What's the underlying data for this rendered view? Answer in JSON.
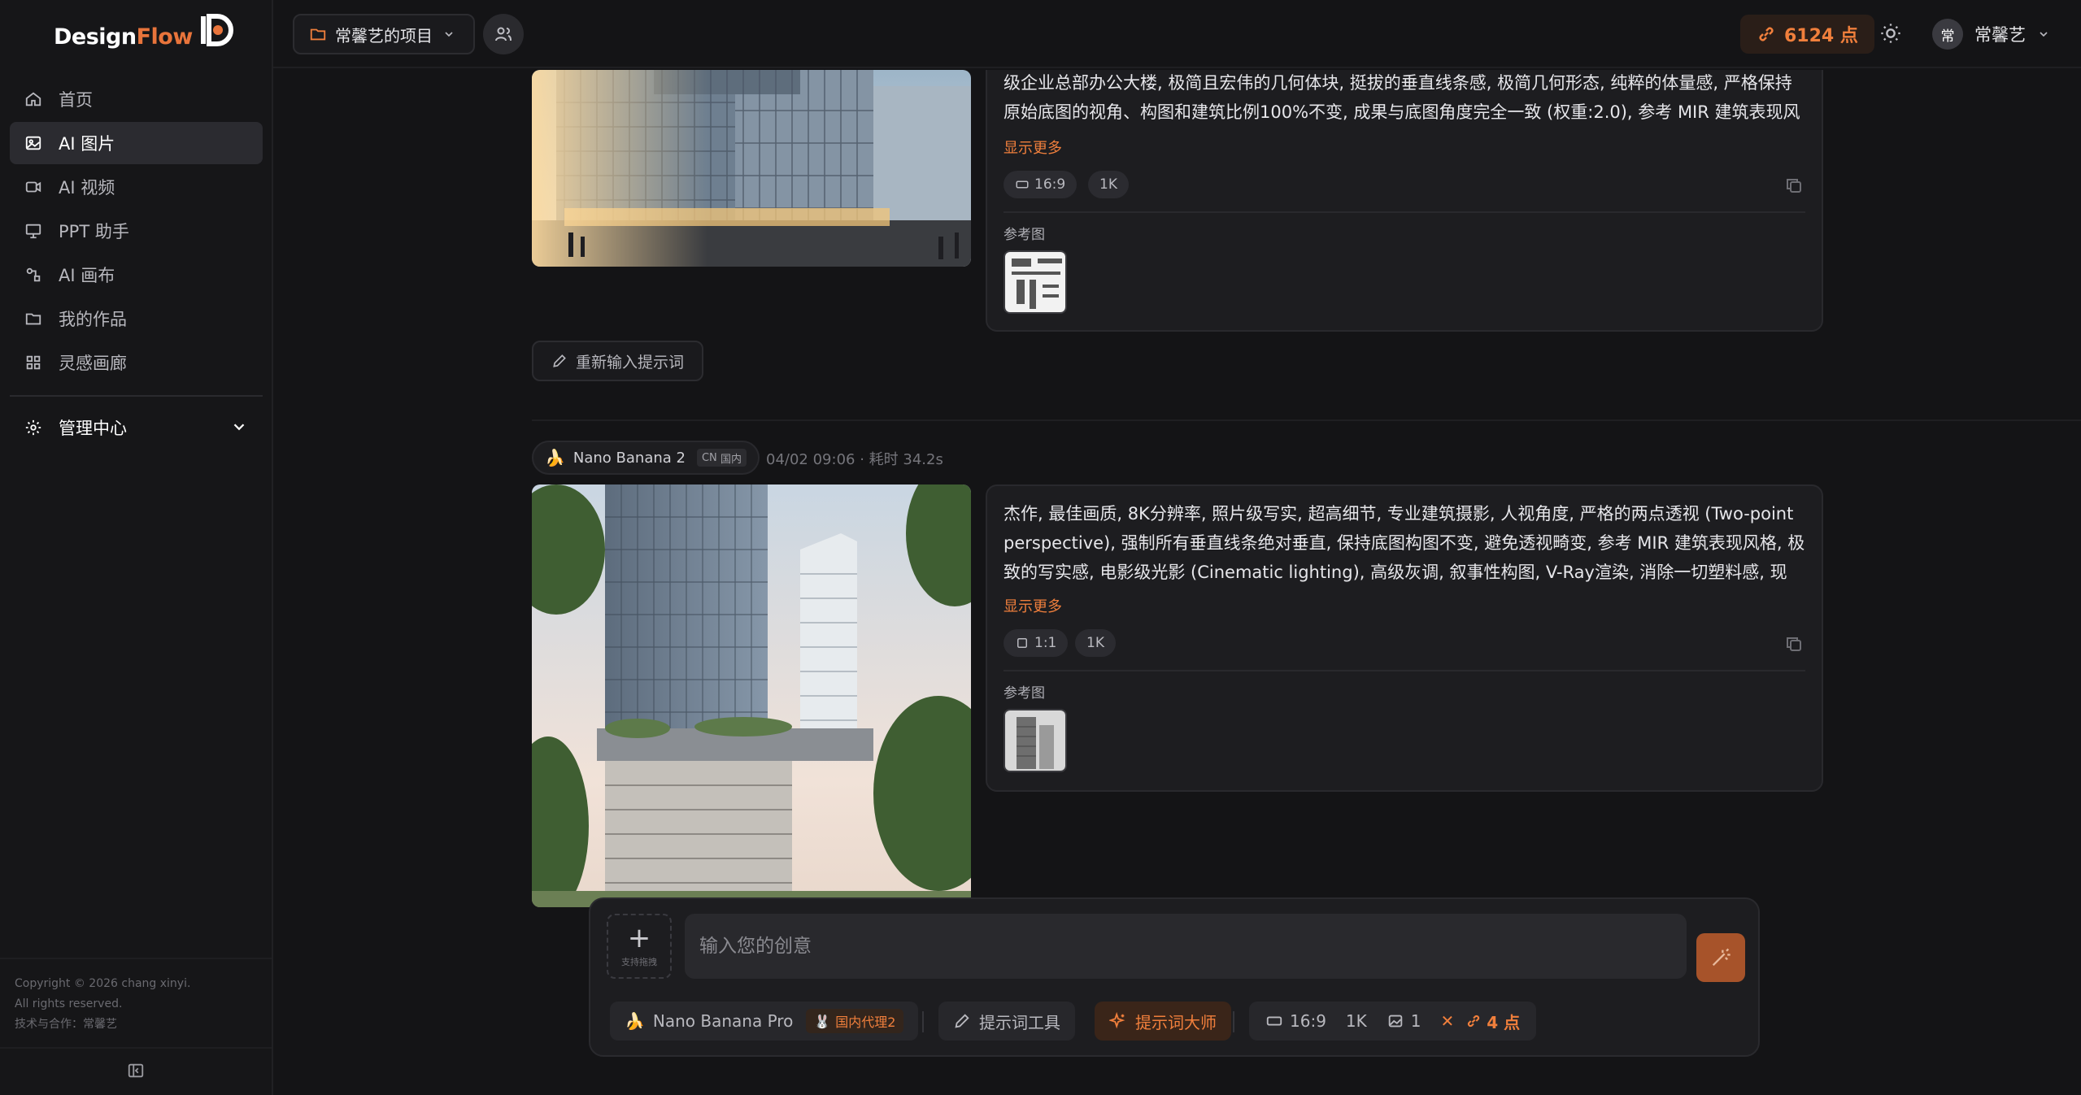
{
  "brand": {
    "name_a": "Design",
    "name_b": "Flow"
  },
  "nav": {
    "items": [
      {
        "label": "首页",
        "icon": "home-icon"
      },
      {
        "label": "AI 图片",
        "icon": "image-icon"
      },
      {
        "label": "AI 视频",
        "icon": "video-icon"
      },
      {
        "label": "PPT 助手",
        "icon": "presentation-icon"
      },
      {
        "label": "AI 画布",
        "icon": "canvas-icon"
      },
      {
        "label": "我的作品",
        "icon": "folder-icon"
      },
      {
        "label": "灵感画廊",
        "icon": "grid-icon"
      }
    ],
    "active_index": 1,
    "admin_label": "管理中心"
  },
  "footer": {
    "line1": "Copyright © 2026 chang xinyi.",
    "line2": "All rights reserved.",
    "line3": "技术与合作：常馨艺"
  },
  "header": {
    "project_label": "常馨艺的项目",
    "points_label": "6124 点",
    "user_avatar": "常",
    "user_name": "常馨艺"
  },
  "results": [
    {
      "prompt": "级企业总部办公大楼, 极简且宏伟的几何体块, 挺拔的垂直线条感, 极简几何形态, 纯粹的体量感, 严格保持原始底图的视角、构图和建筑比例100%不变, 成果与底图角度完全一致 (权重:2.0), 参考 MIR 建筑表现风格...",
      "show_more": "显示更多",
      "ratio": "16:9",
      "resolution": "1K",
      "ref_label": "参考图"
    },
    {
      "model": "Nano Banana 2",
      "region_code": "CN",
      "region": "国内",
      "time": "04/02 09:06",
      "duration": "· 耗时 34.2s",
      "prompt": "杰作, 最佳画质, 8K分辨率, 照片级写实, 超高细节, 专业建筑摄影, 人视角度, 严格的两点透视 (Two-point perspective), 强制所有垂直线条绝对垂直, 保持底图构图不变, 避免透视畸变, 参考 MIR 建筑表现风格, 极致的写实感, 电影级光影 (Cinematic lighting), 高级灰调, 叙事性构图, V-Ray渲染, 消除一切塑料感, 现代...",
      "show_more": "显示更多",
      "ratio": "1:1",
      "resolution": "1K",
      "ref_label": "参考图"
    }
  ],
  "retry_label": "重新输入提示词",
  "composer": {
    "upload_hint": "支持拖拽",
    "placeholder": "输入您的创意",
    "model": "Nano Banana Pro",
    "proxy": "国内代理2",
    "prompt_tool": "提示词工具",
    "prompt_master": "提示词大师",
    "ratio": "16:9",
    "resolution": "1K",
    "count": "1",
    "cost": "4 点"
  },
  "colors": {
    "accent": "#f07f3c",
    "background": "#141416",
    "panel": "#1d1d20"
  }
}
